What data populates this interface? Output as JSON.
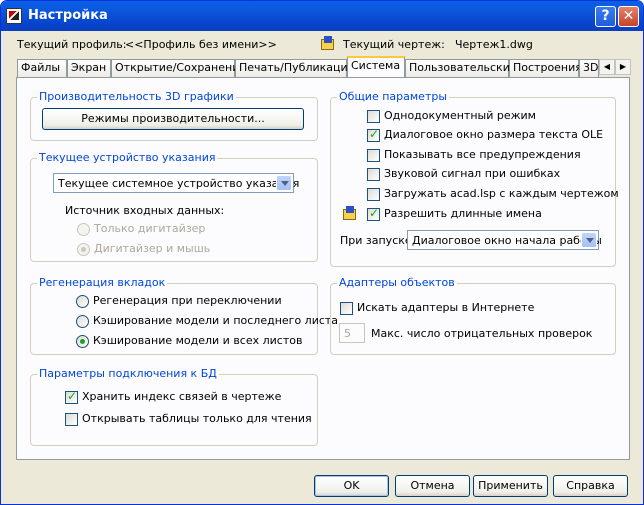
{
  "window": {
    "title": "Настройка",
    "help_glyph": "?",
    "close_glyph": "✕"
  },
  "profile": {
    "label": "Текущий профиль:",
    "value": "<<Профиль без имени>>"
  },
  "drawing": {
    "label": "Текущий чертеж:",
    "value": "Чертеж1.dwg",
    "icon": "drawing-file-icon"
  },
  "tabs": [
    {
      "label": "Файлы"
    },
    {
      "label": "Экран"
    },
    {
      "label": "Открытие/Сохранение"
    },
    {
      "label": "Печать/Публикация"
    },
    {
      "label": "Система",
      "active": true
    },
    {
      "label": "Пользовательские"
    },
    {
      "label": "Построения"
    },
    {
      "label": "3D"
    }
  ],
  "perf3d": {
    "title": "Производительность 3D графики",
    "button": "Режимы производительности..."
  },
  "pointing": {
    "title": "Текущее устройство указания",
    "device": "Текущее системное устройство указания",
    "input_label": "Источник входных данных:",
    "options": [
      {
        "label": "Только дигитайзер",
        "checked": false,
        "enabled": false
      },
      {
        "label": "Дигитайзер и мышь",
        "checked": true,
        "enabled": false
      }
    ]
  },
  "regen": {
    "title": "Регенерация вкладок",
    "options": [
      {
        "label": "Регенерация при переключении",
        "checked": false
      },
      {
        "label": "Кэширование модели и последнего листа",
        "checked": false
      },
      {
        "label": "Кэширование модели и всех листов",
        "checked": true
      }
    ]
  },
  "db": {
    "title": "Параметры подключения к БД",
    "options": [
      {
        "label": "Хранить индекс связей в чертеже",
        "checked": true
      },
      {
        "label": "Открывать таблицы только для чтения",
        "checked": false
      }
    ]
  },
  "general": {
    "title": "Общие параметры",
    "options": [
      {
        "label": "Однодокументный режим",
        "checked": false
      },
      {
        "label": "Диалоговое окно размера текста OLE",
        "checked": true
      },
      {
        "label": "Показывать все предупреждения",
        "checked": false
      },
      {
        "label": "Звуковой сигнал при ошибках",
        "checked": false
      },
      {
        "label": "Загружать acad.lsp с каждым чертежом",
        "checked": false
      },
      {
        "label": "Разрешить длинные имена",
        "checked": true
      }
    ],
    "startup_label": "При запуске:",
    "startup_value": "Диалоговое окно начала работы"
  },
  "adapters": {
    "title": "Адаптеры объектов",
    "search_label": "Искать адаптеры в Интернете",
    "search_checked": false,
    "max_checks_value": "5",
    "max_checks_label": "Макс. число отрицательных проверок"
  },
  "buttons": {
    "ok": "OK",
    "cancel": "Отмена",
    "apply": "Применить",
    "help": "Справка"
  },
  "colors": {
    "title_bar": "#0a5fe8",
    "group_title": "#0046d5",
    "check_mark": "#21a121"
  }
}
